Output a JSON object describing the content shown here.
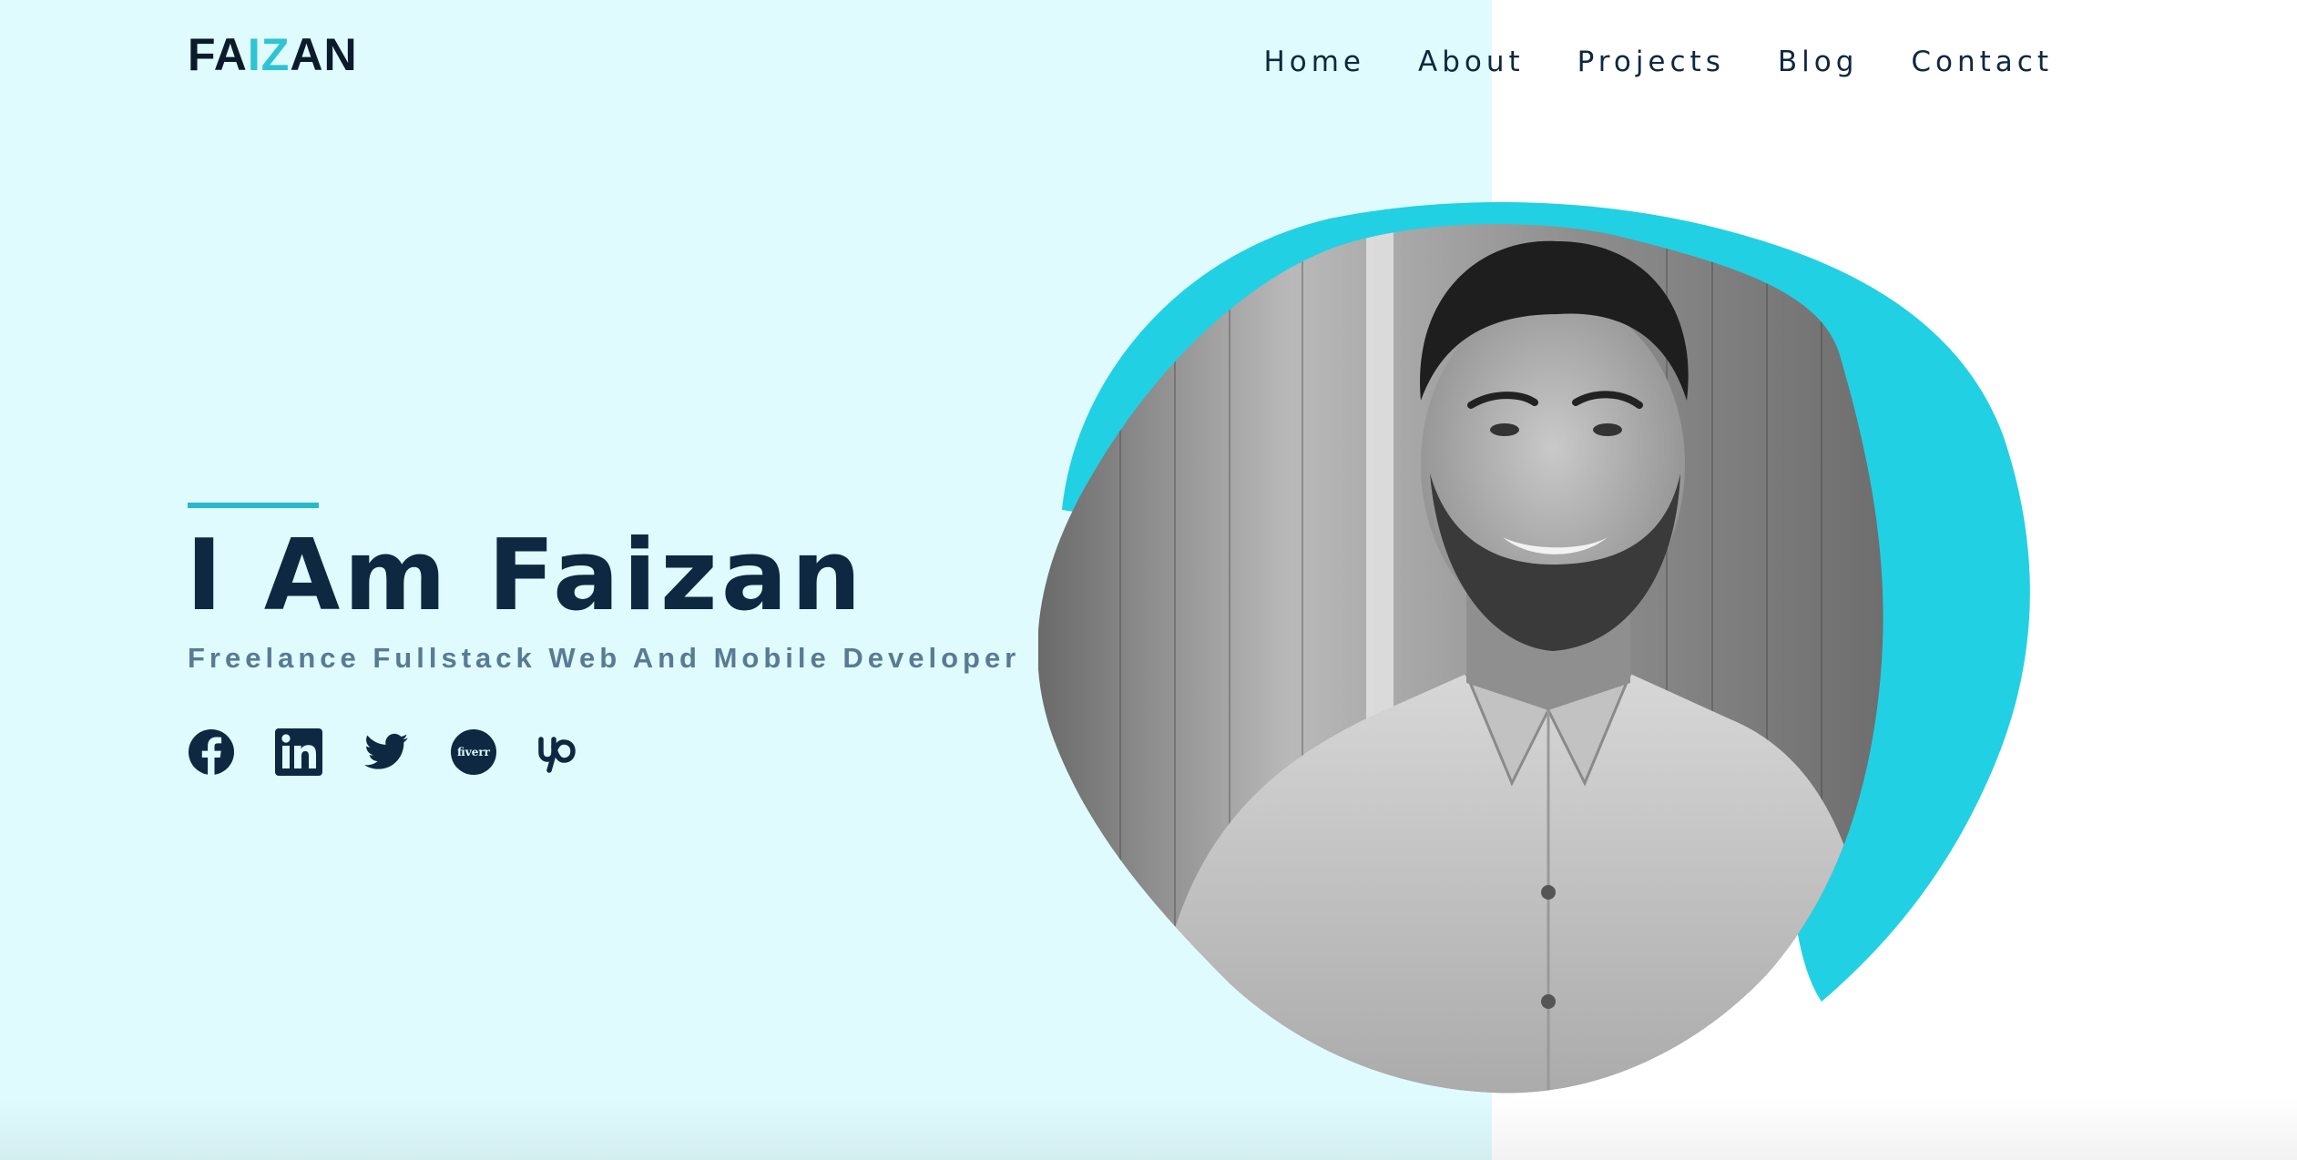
{
  "brand": {
    "logo_parts": [
      "FA",
      "IZ",
      "AN"
    ]
  },
  "nav": {
    "items": [
      "Home",
      "About",
      "Projects",
      "Blog",
      "Contact"
    ]
  },
  "hero": {
    "title": "I Am Faizan",
    "subtitle": "Freelance Fullstack Web And Mobile Developer"
  },
  "socials": [
    {
      "icon": "facebook-icon"
    },
    {
      "icon": "linkedin-icon"
    },
    {
      "icon": "twitter-icon"
    },
    {
      "icon": "fiverr-icon",
      "label": "fiverr"
    },
    {
      "icon": "upwork-icon"
    }
  ],
  "colors": {
    "left_background": "#dffbfd",
    "accent": "#22d0e3",
    "dark_text": "#0e2841",
    "subtitle_text": "#5a7a94"
  }
}
